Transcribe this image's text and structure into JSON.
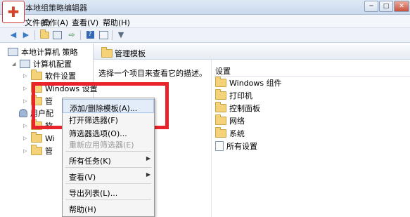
{
  "window": {
    "title": "本地组策略编辑器",
    "app_icon_glyph": "✚",
    "buttons": [
      "─",
      "□",
      "✕"
    ]
  },
  "menubar": {
    "items": [
      "文件(F)",
      "操作(A)",
      "查看(V)",
      "帮助(H)"
    ]
  },
  "toolbar": {
    "icons": [
      "back-arrow-icon",
      "forward-arrow-icon",
      "folder-up-icon",
      "show-hide-tree-icon",
      "export-icon",
      "help-icon",
      "properties-icon",
      "filter-icon"
    ]
  },
  "tree": {
    "root": "本地计算机 策略",
    "computer_config": "计算机配置",
    "software_settings": "软件设置",
    "windows_settings": "Windows 设置",
    "admin_templates_partial": "管",
    "user_config_partial": "用户配",
    "user_software_partial": "软",
    "user_windows_partial": "Wi",
    "user_admin_partial": "管"
  },
  "details": {
    "header_title": "管理模板",
    "description": "选择一个项目来查看它的描述。",
    "column_header": "设置",
    "items": [
      "Windows 组件",
      "打印机",
      "控制面板",
      "网络",
      "系统",
      "所有设置"
    ]
  },
  "context_menu": {
    "items": [
      {
        "label": "添加/删除模板(A)...",
        "state": "highlighted"
      },
      {
        "label": "打开筛选器(F)",
        "state": "normal"
      },
      {
        "label": "筛选器选项(O)...",
        "state": "normal"
      },
      {
        "label": "重新应用筛选器(E)",
        "state": "disabled"
      },
      {
        "label": "所有任务(K)",
        "state": "submenu"
      },
      {
        "label": "查看(V)",
        "state": "submenu"
      },
      {
        "label": "导出列表(L)...",
        "state": "normal"
      },
      {
        "label": "帮助(H)",
        "state": "normal"
      }
    ]
  },
  "colors": {
    "highlight_box": "#e8232b",
    "folder": "#f3d27a",
    "menu_hover": "#e3edf9"
  }
}
